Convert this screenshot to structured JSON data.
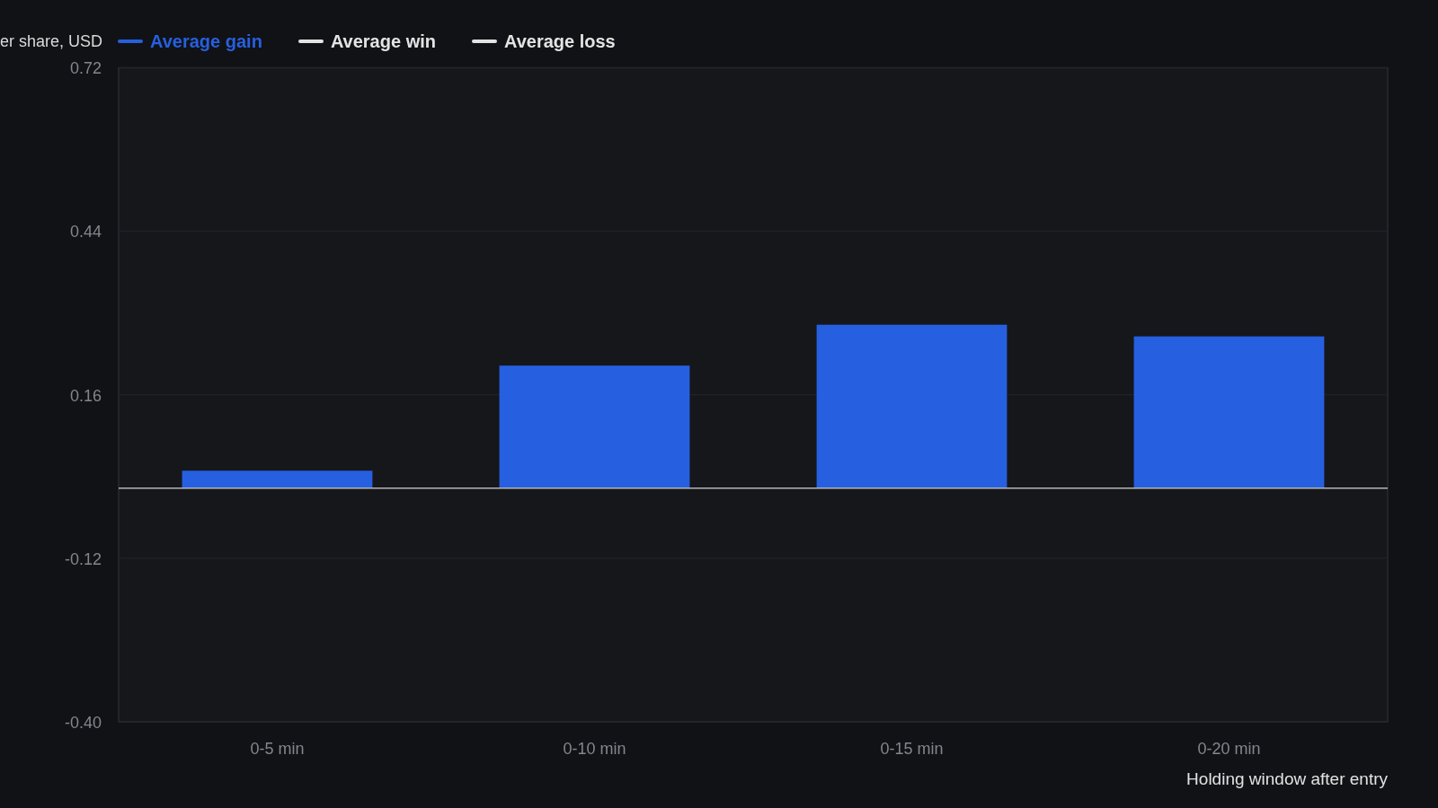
{
  "chart": {
    "chart_data": {
      "type": "bar",
      "ylabel": "er share, USD",
      "xlabel": "Holding window after entry",
      "categories": [
        "0-5 min",
        "0-10 min",
        "0-15 min",
        "0-20 min"
      ],
      "series": [
        {
          "name": "Average gain",
          "color": "#2660e0",
          "values": [
            0.03,
            0.21,
            0.28,
            0.26
          ]
        },
        {
          "name": "Average win",
          "color": "#e4e4e4",
          "values": [
            null,
            null,
            null,
            null
          ]
        },
        {
          "name": "Average loss",
          "color": "#e4e4e4",
          "values": [
            null,
            null,
            null,
            null
          ]
        }
      ],
      "ylim": [
        -0.4,
        0.72
      ],
      "yticks": [
        0.72,
        0.44,
        0.16,
        -0.12,
        {
          "value": -0.4,
          "label": "-0.40"
        }
      ],
      "grid": true
    }
  }
}
